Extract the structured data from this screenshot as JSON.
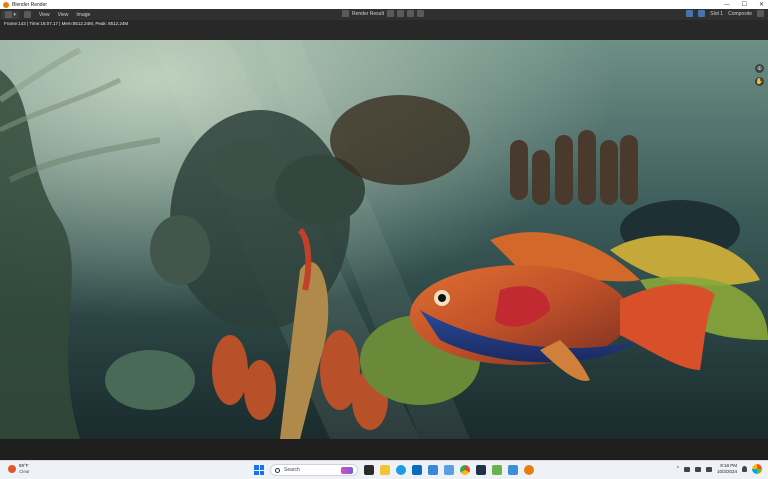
{
  "window": {
    "title": "Blender Render",
    "controls": [
      "—",
      "☐",
      "✕"
    ]
  },
  "header": {
    "menus": [
      "View",
      "View",
      "Image"
    ],
    "image_name": "Render Result",
    "slot": "Slot 1",
    "pass": "Composite"
  },
  "info": {
    "stats": "Frame:143 | Time:16:07.17 | Mem:8512.24M, Peak: 8512.24M"
  },
  "taskbar": {
    "weather": {
      "temp": "89°F",
      "condition": "Clear"
    },
    "search_placeholder": "Search",
    "clock": {
      "time": "9:18 PM",
      "date": "10/3/2024"
    }
  },
  "colors": {
    "accent_blender": "#e87d0d",
    "windows_blue": "#1a73e8",
    "header_bg": "#303030"
  }
}
